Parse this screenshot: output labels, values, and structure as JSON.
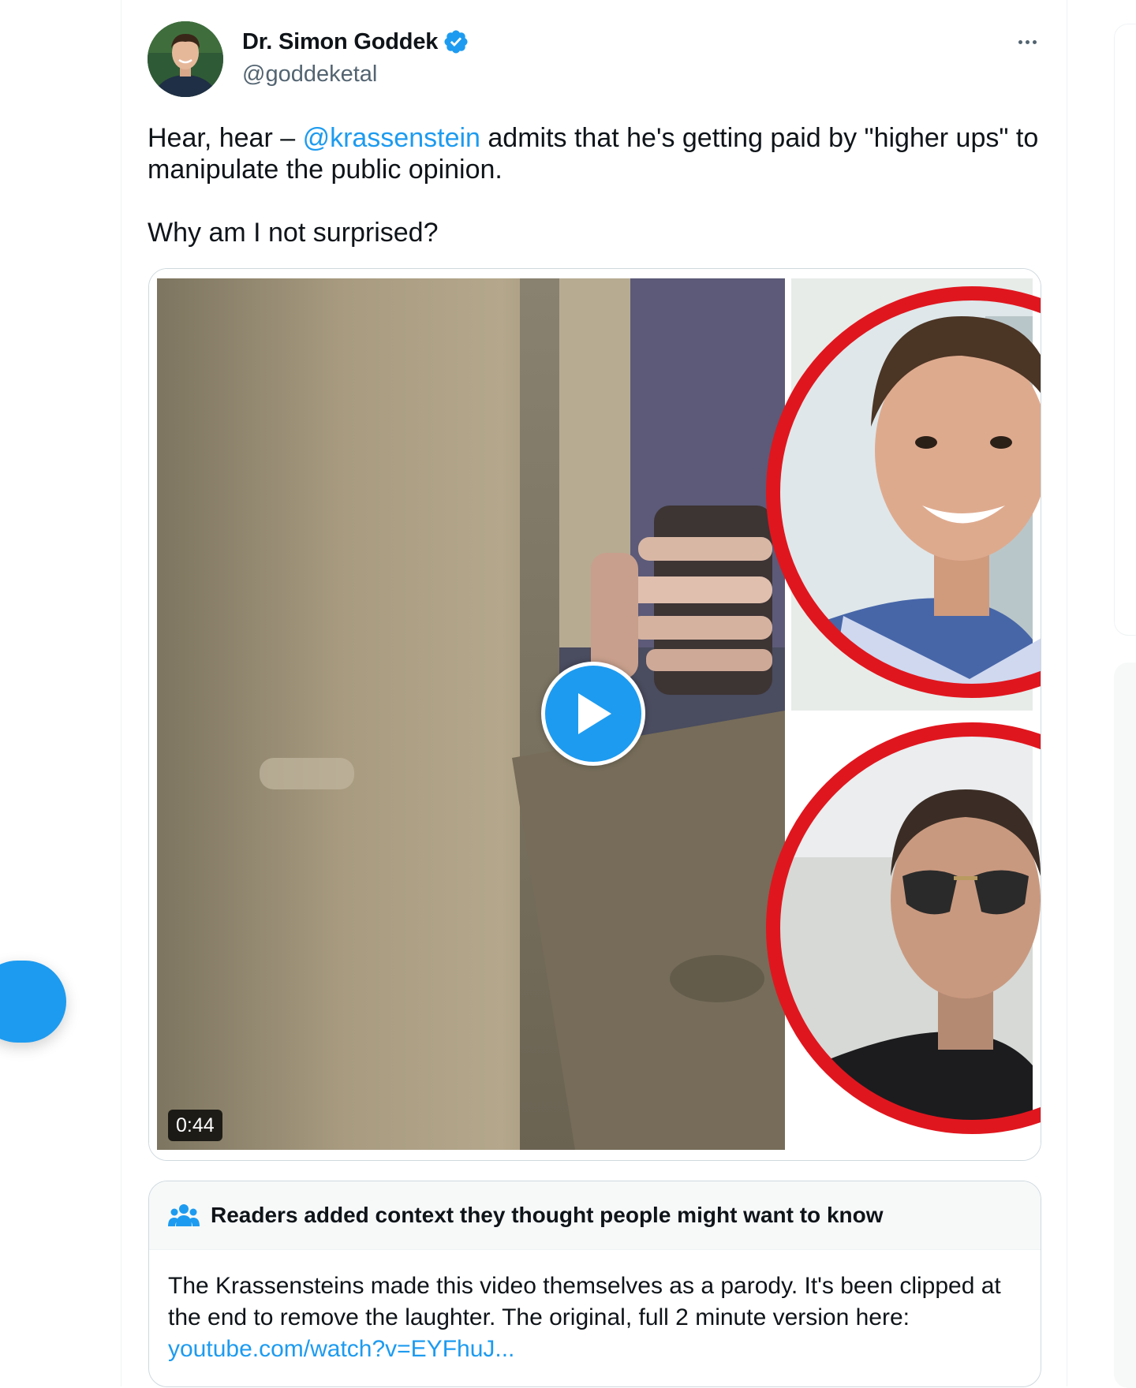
{
  "author": {
    "name": "Dr. Simon Goddek",
    "handle": "@goddeketal",
    "verified_color": "#1d9bf0"
  },
  "tweet": {
    "line1_prefix": "Hear, hear – ",
    "mention": "@krassenstein",
    "line1_suffix": " admits that he's getting paid by \"higher ups\" to manipulate the public opinion.",
    "line2": "Why am I not surprised?"
  },
  "media": {
    "duration": "0:44",
    "play_icon": "play-icon"
  },
  "community_note": {
    "title": "Readers added context they thought people might want to know",
    "body": "The Krassensteins made this video themselves as a parody. It's been clipped at the end to remove the laughter. The original, full 2 minute version here:",
    "link": "youtube.com/watch?v=EYFhuJ..."
  },
  "colors": {
    "accent": "#1d9bf0",
    "text": "#0f1419",
    "secondary_text": "#536471",
    "ring_red": "#e0161e"
  }
}
